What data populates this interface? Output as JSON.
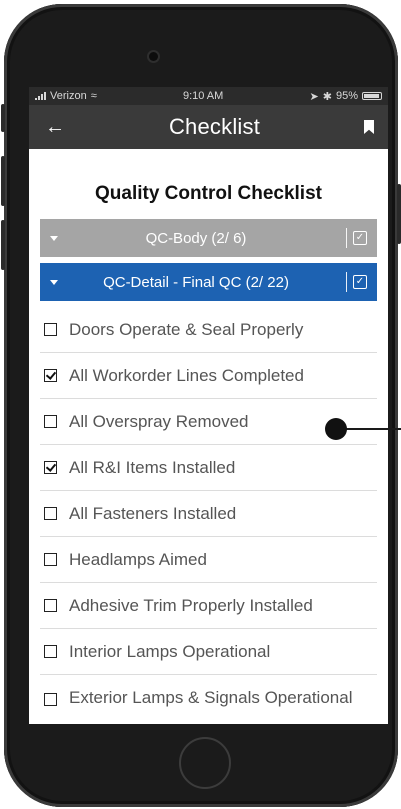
{
  "status_bar": {
    "carrier": "Verizon",
    "time": "9:10 AM",
    "battery_percent": "95%"
  },
  "nav": {
    "back_icon": "arrow-left-icon",
    "title": "Checklist",
    "bookmark_icon": "bookmark-icon"
  },
  "page_title": "Quality Control Checklist",
  "sections": [
    {
      "label": "QC-Body (2/ 6)",
      "color": "#a5a5a5"
    },
    {
      "label": "QC-Detail - Final QC (2/ 22)",
      "color": "#1d62b2"
    }
  ],
  "items": [
    {
      "label": "Doors Operate & Seal Properly",
      "checked": false
    },
    {
      "label": "All Workorder Lines Completed",
      "checked": true
    },
    {
      "label": "All Overspray Removed",
      "checked": false
    },
    {
      "label": "All R&I Items Installed",
      "checked": true
    },
    {
      "label": "All Fasteners Installed",
      "checked": false
    },
    {
      "label": "Headlamps Aimed",
      "checked": false
    },
    {
      "label": "Adhesive Trim Properly Installed",
      "checked": false
    },
    {
      "label": "Interior Lamps Operational",
      "checked": false
    },
    {
      "label": "Exterior Lamps & Signals Operational",
      "checked": false
    }
  ],
  "colors": {
    "nav_bg": "#3a3a3a",
    "section_grey": "#a5a5a5",
    "section_blue": "#1d62b2"
  }
}
